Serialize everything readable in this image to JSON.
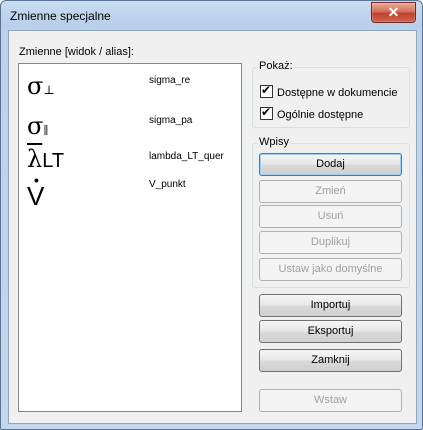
{
  "window": {
    "title": "Zmienne specjalne",
    "close_glyph": "✕"
  },
  "list": {
    "label": "Zmienne [widok / alias]:",
    "items": [
      {
        "symbol": "σ",
        "sub": "⊥",
        "alias": "sigma_re"
      },
      {
        "symbol": "σ",
        "sub": "∥",
        "alias": "sigma_pa"
      },
      {
        "symbol": "λ",
        "sub": "LT",
        "alias": "lambda_LT_quer"
      },
      {
        "symbol": "V",
        "sub": "",
        "alias": "V_punkt"
      }
    ]
  },
  "show": {
    "legend": "Pokaż:",
    "options": [
      {
        "label": "Dostępne w dokumencie",
        "checked": true
      },
      {
        "label": "Ogólnie dostępne",
        "checked": true
      }
    ]
  },
  "entries": {
    "legend": "Wpisy",
    "add": "Dodaj",
    "change": "Zmień",
    "delete": "Usuń",
    "duplicate": "Duplikuj",
    "set_default": "Ustaw jako domyślne"
  },
  "actions": {
    "import": "Importuj",
    "export": "Eksportuj",
    "close": "Zamknij",
    "insert": "Wstaw"
  }
}
